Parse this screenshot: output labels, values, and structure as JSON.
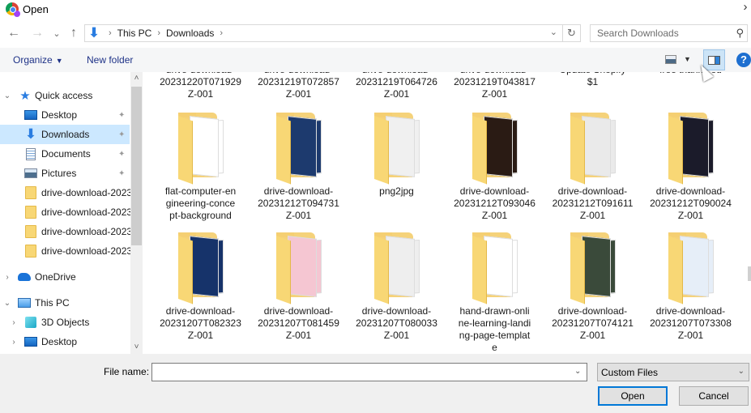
{
  "window": {
    "title": "Open",
    "close_glyph": "✕"
  },
  "nav": {
    "back_glyph": "←",
    "forward_glyph": "→",
    "recent_glyph": "⌄",
    "up_glyph": "↑",
    "location_icon": "downloads-arrow",
    "breadcrumb": [
      "This PC",
      "Downloads"
    ],
    "separator": "›",
    "dropdown_glyph": "⌄",
    "refresh_glyph": "↻",
    "search_placeholder": "Search Downloads",
    "search_glyph": "⌕"
  },
  "commandbar": {
    "organize_label": "Organize",
    "organize_caret": "▼",
    "new_folder_label": "New folder",
    "view_caret": "▼",
    "help_glyph": "?"
  },
  "sidebar": {
    "items": [
      {
        "label": "Quick access",
        "icon": "quick-access-star",
        "chevron": "⌄",
        "pinned": false,
        "selected": false
      },
      {
        "label": "Desktop",
        "icon": "desktop",
        "pinned": true,
        "selected": false
      },
      {
        "label": "Downloads",
        "icon": "downloads",
        "pinned": true,
        "selected": true
      },
      {
        "label": "Documents",
        "icon": "documents",
        "pinned": true,
        "selected": false
      },
      {
        "label": "Pictures",
        "icon": "pictures",
        "pinned": true,
        "selected": false
      },
      {
        "label": "drive-download-2023",
        "icon": "folder",
        "pinned": false,
        "selected": false
      },
      {
        "label": "drive-download-2023",
        "icon": "folder",
        "pinned": false,
        "selected": false
      },
      {
        "label": "drive-download-2023",
        "icon": "folder",
        "pinned": false,
        "selected": false
      },
      {
        "label": "drive-download-2023",
        "icon": "folder",
        "pinned": false,
        "selected": false
      },
      {
        "label": "OneDrive",
        "icon": "onedrive-cloud",
        "chevron": "›",
        "pinned": false,
        "selected": false
      },
      {
        "label": "This PC",
        "icon": "this-pc",
        "chevron": "⌄",
        "pinned": false,
        "selected": false
      },
      {
        "label": "3D Objects",
        "icon": "3d-objects",
        "chevron": "›",
        "pinned": false,
        "selected": false
      },
      {
        "label": "Desktop",
        "icon": "desktop",
        "chevron": "›",
        "pinned": false,
        "selected": false
      }
    ],
    "pin_glyph": "📌",
    "scroll_up": "˄",
    "scroll_down": "˅"
  },
  "files": {
    "row0_partial": [
      {
        "line1": "drive-download-",
        "line2": "20231220T071929",
        "line3": "Z-001"
      },
      {
        "line1": "drive-download-",
        "line2": "20231219T072857",
        "line3": "Z-001"
      },
      {
        "line1": "drive-download-",
        "line2": "20231219T064726",
        "line3": "Z-001"
      },
      {
        "line1": "drive-download-",
        "line2": "20231219T043817",
        "line3": "Z-001"
      },
      {
        "line1": "Update Shopify",
        "line2": "$1",
        "line3": ""
      },
      {
        "line1": "free thank-you",
        "line2": "",
        "line3": ""
      }
    ],
    "items": [
      {
        "name": "flat-computer-engineering-concept-background",
        "lines": [
          "flat-computer-en",
          "gineering-conce",
          "pt-background"
        ]
      },
      {
        "name": "drive-download-20231212T094731Z-001",
        "lines": [
          "drive-download-",
          "20231212T094731",
          "Z-001"
        ]
      },
      {
        "name": "png2jpg",
        "lines": [
          "png2jpg"
        ]
      },
      {
        "name": "drive-download-20231212T093046Z-001",
        "lines": [
          "drive-download-",
          "20231212T093046",
          "Z-001"
        ]
      },
      {
        "name": "drive-download-20231212T091611Z-001",
        "lines": [
          "drive-download-",
          "20231212T091611",
          "Z-001"
        ]
      },
      {
        "name": "drive-download-20231212T090024Z-001",
        "lines": [
          "drive-download-",
          "20231212T090024",
          "Z-001"
        ]
      },
      {
        "name": "drive-download-20231207T082323Z-001",
        "lines": [
          "drive-download-",
          "20231207T082323",
          "Z-001"
        ]
      },
      {
        "name": "drive-download-20231207T081459Z-001",
        "lines": [
          "drive-download-",
          "20231207T081459",
          "Z-001"
        ]
      },
      {
        "name": "drive-download-20231207T080033Z-001",
        "lines": [
          "drive-download-",
          "20231207T080033",
          "Z-001"
        ]
      },
      {
        "name": "hand-drawn-online-learning-landing-page-template",
        "lines": [
          "hand-drawn-onli",
          "ne-learning-landi",
          "ng-page-templat",
          "e"
        ]
      },
      {
        "name": "drive-download-20231207T074121Z-001",
        "lines": [
          "drive-download-",
          "20231207T074121",
          "Z-001"
        ]
      },
      {
        "name": "drive-download-20231207T073308Z-001",
        "lines": [
          "drive-download-",
          "20231207T073308",
          "Z-001"
        ]
      }
    ],
    "thumb_colors": [
      "#ffffff",
      "#1d3a6e",
      "#f0f0f0",
      "#2a1b14",
      "#eaeaea",
      "#1b1b2a",
      "#16336a",
      "#f5c6d2",
      "#eeeeee",
      "#ffffff",
      "#3a4a3a",
      "#e6eef8"
    ]
  },
  "footer": {
    "file_name_label": "File name:",
    "file_name_value": "",
    "file_name_drop": "⌄",
    "filter_value": "Custom Files",
    "filter_caret": "⌄",
    "open_label": "Open",
    "cancel_label": "Cancel"
  },
  "colors": {
    "selection": "#cce8ff",
    "accent": "#0078d7",
    "folder": "#f8d775",
    "command_text": "#1e3287"
  }
}
